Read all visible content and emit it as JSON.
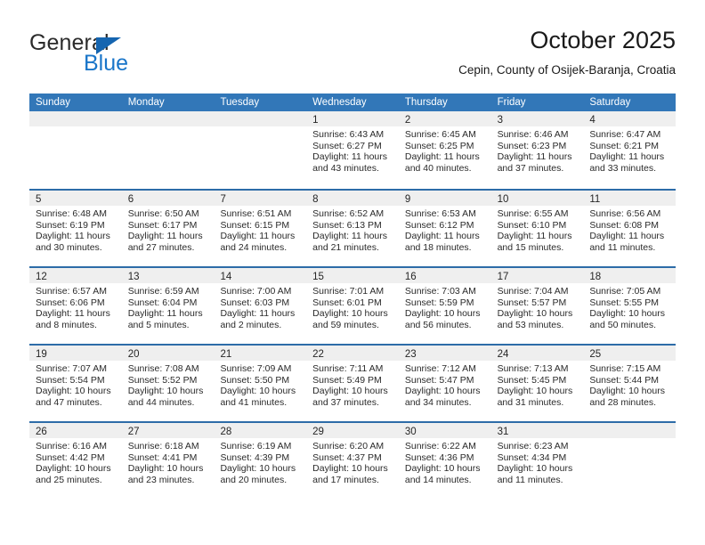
{
  "brand": {
    "name_top": "General",
    "name_bottom": "Blue",
    "triangle_color": "#1565b0",
    "blue_text_color": "#1975c9"
  },
  "header": {
    "title": "October 2025",
    "subtitle": "Cepin, County of Osijek-Baranja, Croatia"
  },
  "theme": {
    "header_bar": "#3277b8",
    "row_divider": "#2d6ca8",
    "day_band": "#efefef"
  },
  "weekday_headers": [
    "Sunday",
    "Monday",
    "Tuesday",
    "Wednesday",
    "Thursday",
    "Friday",
    "Saturday"
  ],
  "weeks": [
    [
      {
        "day": "",
        "sunrise": "",
        "sunset": "",
        "daylight_1": "",
        "daylight_2": ""
      },
      {
        "day": "",
        "sunrise": "",
        "sunset": "",
        "daylight_1": "",
        "daylight_2": ""
      },
      {
        "day": "",
        "sunrise": "",
        "sunset": "",
        "daylight_1": "",
        "daylight_2": ""
      },
      {
        "day": "1",
        "sunrise": "Sunrise: 6:43 AM",
        "sunset": "Sunset: 6:27 PM",
        "daylight_1": "Daylight: 11 hours",
        "daylight_2": "and 43 minutes."
      },
      {
        "day": "2",
        "sunrise": "Sunrise: 6:45 AM",
        "sunset": "Sunset: 6:25 PM",
        "daylight_1": "Daylight: 11 hours",
        "daylight_2": "and 40 minutes."
      },
      {
        "day": "3",
        "sunrise": "Sunrise: 6:46 AM",
        "sunset": "Sunset: 6:23 PM",
        "daylight_1": "Daylight: 11 hours",
        "daylight_2": "and 37 minutes."
      },
      {
        "day": "4",
        "sunrise": "Sunrise: 6:47 AM",
        "sunset": "Sunset: 6:21 PM",
        "daylight_1": "Daylight: 11 hours",
        "daylight_2": "and 33 minutes."
      }
    ],
    [
      {
        "day": "5",
        "sunrise": "Sunrise: 6:48 AM",
        "sunset": "Sunset: 6:19 PM",
        "daylight_1": "Daylight: 11 hours",
        "daylight_2": "and 30 minutes."
      },
      {
        "day": "6",
        "sunrise": "Sunrise: 6:50 AM",
        "sunset": "Sunset: 6:17 PM",
        "daylight_1": "Daylight: 11 hours",
        "daylight_2": "and 27 minutes."
      },
      {
        "day": "7",
        "sunrise": "Sunrise: 6:51 AM",
        "sunset": "Sunset: 6:15 PM",
        "daylight_1": "Daylight: 11 hours",
        "daylight_2": "and 24 minutes."
      },
      {
        "day": "8",
        "sunrise": "Sunrise: 6:52 AM",
        "sunset": "Sunset: 6:13 PM",
        "daylight_1": "Daylight: 11 hours",
        "daylight_2": "and 21 minutes."
      },
      {
        "day": "9",
        "sunrise": "Sunrise: 6:53 AM",
        "sunset": "Sunset: 6:12 PM",
        "daylight_1": "Daylight: 11 hours",
        "daylight_2": "and 18 minutes."
      },
      {
        "day": "10",
        "sunrise": "Sunrise: 6:55 AM",
        "sunset": "Sunset: 6:10 PM",
        "daylight_1": "Daylight: 11 hours",
        "daylight_2": "and 15 minutes."
      },
      {
        "day": "11",
        "sunrise": "Sunrise: 6:56 AM",
        "sunset": "Sunset: 6:08 PM",
        "daylight_1": "Daylight: 11 hours",
        "daylight_2": "and 11 minutes."
      }
    ],
    [
      {
        "day": "12",
        "sunrise": "Sunrise: 6:57 AM",
        "sunset": "Sunset: 6:06 PM",
        "daylight_1": "Daylight: 11 hours",
        "daylight_2": "and 8 minutes."
      },
      {
        "day": "13",
        "sunrise": "Sunrise: 6:59 AM",
        "sunset": "Sunset: 6:04 PM",
        "daylight_1": "Daylight: 11 hours",
        "daylight_2": "and 5 minutes."
      },
      {
        "day": "14",
        "sunrise": "Sunrise: 7:00 AM",
        "sunset": "Sunset: 6:03 PM",
        "daylight_1": "Daylight: 11 hours",
        "daylight_2": "and 2 minutes."
      },
      {
        "day": "15",
        "sunrise": "Sunrise: 7:01 AM",
        "sunset": "Sunset: 6:01 PM",
        "daylight_1": "Daylight: 10 hours",
        "daylight_2": "and 59 minutes."
      },
      {
        "day": "16",
        "sunrise": "Sunrise: 7:03 AM",
        "sunset": "Sunset: 5:59 PM",
        "daylight_1": "Daylight: 10 hours",
        "daylight_2": "and 56 minutes."
      },
      {
        "day": "17",
        "sunrise": "Sunrise: 7:04 AM",
        "sunset": "Sunset: 5:57 PM",
        "daylight_1": "Daylight: 10 hours",
        "daylight_2": "and 53 minutes."
      },
      {
        "day": "18",
        "sunrise": "Sunrise: 7:05 AM",
        "sunset": "Sunset: 5:55 PM",
        "daylight_1": "Daylight: 10 hours",
        "daylight_2": "and 50 minutes."
      }
    ],
    [
      {
        "day": "19",
        "sunrise": "Sunrise: 7:07 AM",
        "sunset": "Sunset: 5:54 PM",
        "daylight_1": "Daylight: 10 hours",
        "daylight_2": "and 47 minutes."
      },
      {
        "day": "20",
        "sunrise": "Sunrise: 7:08 AM",
        "sunset": "Sunset: 5:52 PM",
        "daylight_1": "Daylight: 10 hours",
        "daylight_2": "and 44 minutes."
      },
      {
        "day": "21",
        "sunrise": "Sunrise: 7:09 AM",
        "sunset": "Sunset: 5:50 PM",
        "daylight_1": "Daylight: 10 hours",
        "daylight_2": "and 41 minutes."
      },
      {
        "day": "22",
        "sunrise": "Sunrise: 7:11 AM",
        "sunset": "Sunset: 5:49 PM",
        "daylight_1": "Daylight: 10 hours",
        "daylight_2": "and 37 minutes."
      },
      {
        "day": "23",
        "sunrise": "Sunrise: 7:12 AM",
        "sunset": "Sunset: 5:47 PM",
        "daylight_1": "Daylight: 10 hours",
        "daylight_2": "and 34 minutes."
      },
      {
        "day": "24",
        "sunrise": "Sunrise: 7:13 AM",
        "sunset": "Sunset: 5:45 PM",
        "daylight_1": "Daylight: 10 hours",
        "daylight_2": "and 31 minutes."
      },
      {
        "day": "25",
        "sunrise": "Sunrise: 7:15 AM",
        "sunset": "Sunset: 5:44 PM",
        "daylight_1": "Daylight: 10 hours",
        "daylight_2": "and 28 minutes."
      }
    ],
    [
      {
        "day": "26",
        "sunrise": "Sunrise: 6:16 AM",
        "sunset": "Sunset: 4:42 PM",
        "daylight_1": "Daylight: 10 hours",
        "daylight_2": "and 25 minutes."
      },
      {
        "day": "27",
        "sunrise": "Sunrise: 6:18 AM",
        "sunset": "Sunset: 4:41 PM",
        "daylight_1": "Daylight: 10 hours",
        "daylight_2": "and 23 minutes."
      },
      {
        "day": "28",
        "sunrise": "Sunrise: 6:19 AM",
        "sunset": "Sunset: 4:39 PM",
        "daylight_1": "Daylight: 10 hours",
        "daylight_2": "and 20 minutes."
      },
      {
        "day": "29",
        "sunrise": "Sunrise: 6:20 AM",
        "sunset": "Sunset: 4:37 PM",
        "daylight_1": "Daylight: 10 hours",
        "daylight_2": "and 17 minutes."
      },
      {
        "day": "30",
        "sunrise": "Sunrise: 6:22 AM",
        "sunset": "Sunset: 4:36 PM",
        "daylight_1": "Daylight: 10 hours",
        "daylight_2": "and 14 minutes."
      },
      {
        "day": "31",
        "sunrise": "Sunrise: 6:23 AM",
        "sunset": "Sunset: 4:34 PM",
        "daylight_1": "Daylight: 10 hours",
        "daylight_2": "and 11 minutes."
      },
      {
        "day": "",
        "sunrise": "",
        "sunset": "",
        "daylight_1": "",
        "daylight_2": ""
      }
    ]
  ]
}
